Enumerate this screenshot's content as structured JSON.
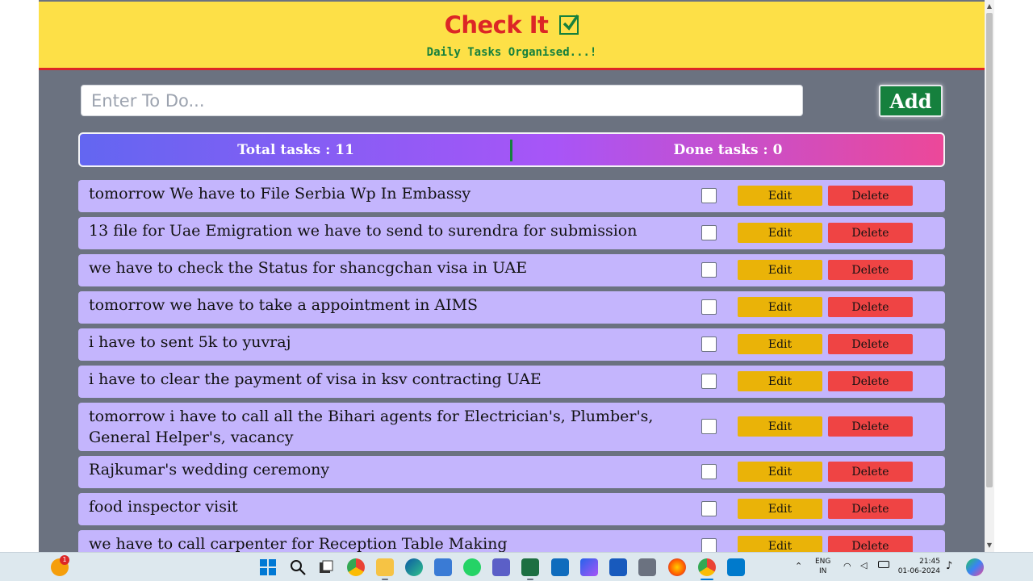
{
  "header": {
    "title": "Check It",
    "subtitle": "Daily Tasks Organised...!"
  },
  "input": {
    "placeholder": "Enter To Do...",
    "value": ""
  },
  "add_label": "Add",
  "stats": {
    "total_label": "Total tasks : 11",
    "done_label": "Done tasks : 0"
  },
  "tasks": [
    {
      "text": "tomorrow We have to File Serbia Wp In Embassy",
      "done": false
    },
    {
      "text": "13 file for Uae Emigration we have to send to surendra for submission",
      "done": false
    },
    {
      "text": "we have to check the Status for shancgchan visa in UAE",
      "done": false
    },
    {
      "text": "tomorrow we have to take a appointment in AIMS",
      "done": false
    },
    {
      "text": "i have to sent 5k to yuvraj",
      "done": false
    },
    {
      "text": "i have to clear the payment of visa in ksv contracting UAE",
      "done": false
    },
    {
      "text": "tomorrow i have to call all the Bihari agents for Electrician's, Plumber's, General Helper's, vacancy",
      "done": false
    },
    {
      "text": "Rajkumar's wedding ceremony",
      "done": false
    },
    {
      "text": "food inspector visit",
      "done": false
    },
    {
      "text": "we have to call carpenter for Reception Table Making",
      "done": false
    }
  ],
  "task_buttons": {
    "edit": "Edit",
    "delete": "Delete"
  },
  "colors": {
    "header_bg": "#fde047",
    "title": "#dc2626",
    "subtitle": "#15803d",
    "page_bg": "#6b7280",
    "task_bg": "#c4b5fd",
    "edit_bg": "#eab308",
    "delete_bg": "#ef4444",
    "add_bg": "#15803d"
  },
  "taskbar": {
    "notification_badge": "1",
    "language": "ENG",
    "region": "IN",
    "time": "21:45",
    "date": "01-06-2024",
    "icons": [
      "weather-icon",
      "windows-start-icon",
      "search-icon",
      "task-view-icon",
      "chrome-icon",
      "file-explorer-icon",
      "edge-icon",
      "store-icon",
      "whatsapp-icon",
      "teams-icon",
      "excel-icon",
      "mail-icon",
      "copilot-icon",
      "word-icon",
      "calculator-icon",
      "firefox-icon",
      "chrome-profile-icon",
      "vscode-icon"
    ]
  }
}
